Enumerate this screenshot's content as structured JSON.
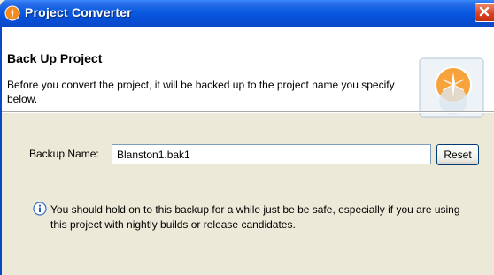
{
  "window": {
    "title": "Project Converter",
    "icon": "app-icon",
    "close_icon": "close-icon"
  },
  "header": {
    "title": "Back Up Project",
    "description": "Before you convert the project, it will be backed up to the project name you specify below.",
    "graphic": "wizard-graphic"
  },
  "form": {
    "backup_label": "Backup Name:",
    "backup_value": "Blanston1.bak1",
    "reset_label": "Reset"
  },
  "info": {
    "icon": "info-icon",
    "text": "You should hold on to this backup for a while just be be safe, especially if you are using this project with nightly builds or release candidates."
  },
  "colors": {
    "titlebar": "#0A5AE0",
    "dialog_bg": "#ECE9D8",
    "header_bg": "#FFFFFF",
    "close_button": "#D84020",
    "input_border": "#7F9DB9"
  }
}
